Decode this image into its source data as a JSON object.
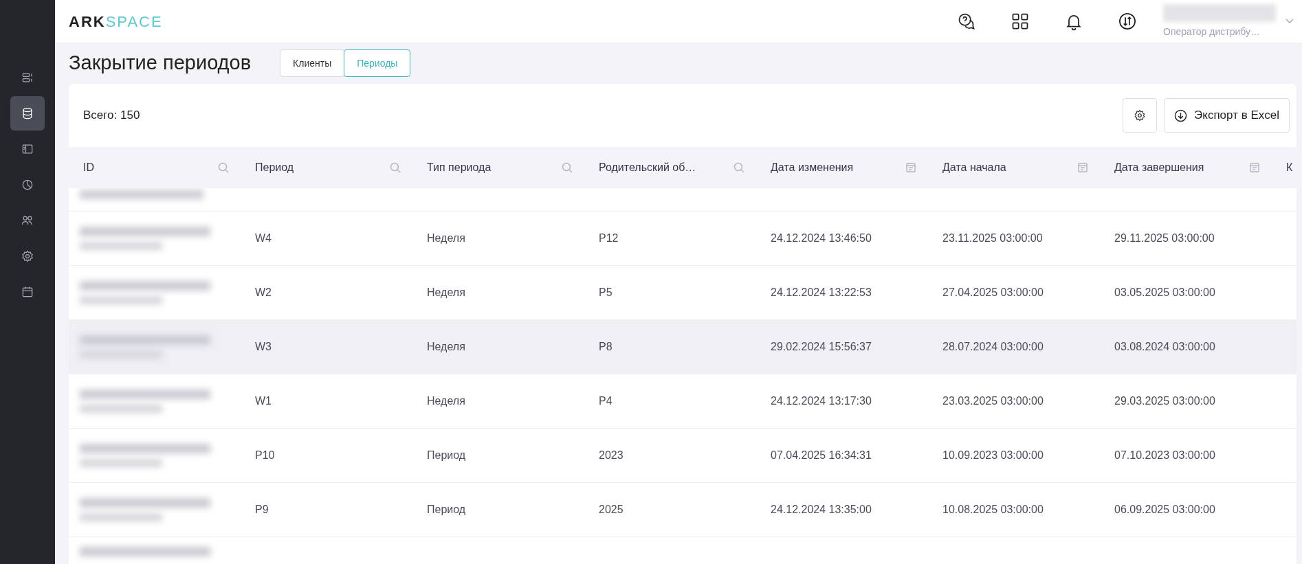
{
  "logo": {
    "first": "ARK",
    "second": "SPACE"
  },
  "sidebar": {
    "items": [
      {
        "selected": false
      },
      {
        "selected": true
      },
      {
        "selected": false
      },
      {
        "selected": false
      },
      {
        "selected": false
      },
      {
        "selected": false
      },
      {
        "selected": false
      }
    ]
  },
  "header": {
    "user_role": "Оператор дистрибу…"
  },
  "page_title": "Закрытие периодов",
  "tabs": [
    {
      "label": "Клиенты",
      "selected": false
    },
    {
      "label": "Периоды",
      "selected": true
    }
  ],
  "total": "Всего: 150",
  "export_button": "Экспорт в Excel",
  "table": {
    "columns": [
      {
        "label": "ID",
        "kind": "search"
      },
      {
        "label": "Период",
        "kind": "search"
      },
      {
        "label": "Тип периода",
        "kind": "search"
      },
      {
        "label": "Родительский об…",
        "kind": "search"
      },
      {
        "label": "Дата изменения",
        "kind": "date"
      },
      {
        "label": "Дата начала",
        "kind": "date"
      },
      {
        "label": "Дата завершения",
        "kind": "date"
      },
      {
        "label": "К",
        "kind": "plain"
      }
    ],
    "rows": [
      {
        "highlighted": false,
        "cells": [
          "",
          "W4",
          "Неделя",
          "P12",
          "24.12.2024 13:46:50",
          "23.11.2025 03:00:00",
          "29.11.2025 03:00:00"
        ]
      },
      {
        "highlighted": false,
        "cells": [
          "",
          "W2",
          "Неделя",
          "P5",
          "24.12.2024 13:22:53",
          "27.04.2025 03:00:00",
          "03.05.2025 03:00:00"
        ]
      },
      {
        "highlighted": true,
        "cells": [
          "",
          "W3",
          "Неделя",
          "P8",
          "29.02.2024 15:56:37",
          "28.07.2024 03:00:00",
          "03.08.2024 03:00:00"
        ]
      },
      {
        "highlighted": false,
        "cells": [
          "",
          "W1",
          "Неделя",
          "P4",
          "24.12.2024 13:17:30",
          "23.03.2025 03:00:00",
          "29.03.2025 03:00:00"
        ]
      },
      {
        "highlighted": false,
        "cells": [
          "",
          "P10",
          "Период",
          "2023",
          "07.04.2025 16:34:31",
          "10.09.2023 03:00:00",
          "07.10.2023 03:00:00"
        ]
      },
      {
        "highlighted": false,
        "cells": [
          "",
          "P9",
          "Период",
          "2025",
          "24.12.2024 13:35:00",
          "10.08.2025 03:00:00",
          "06.09.2025 03:00:00"
        ]
      }
    ]
  }
}
